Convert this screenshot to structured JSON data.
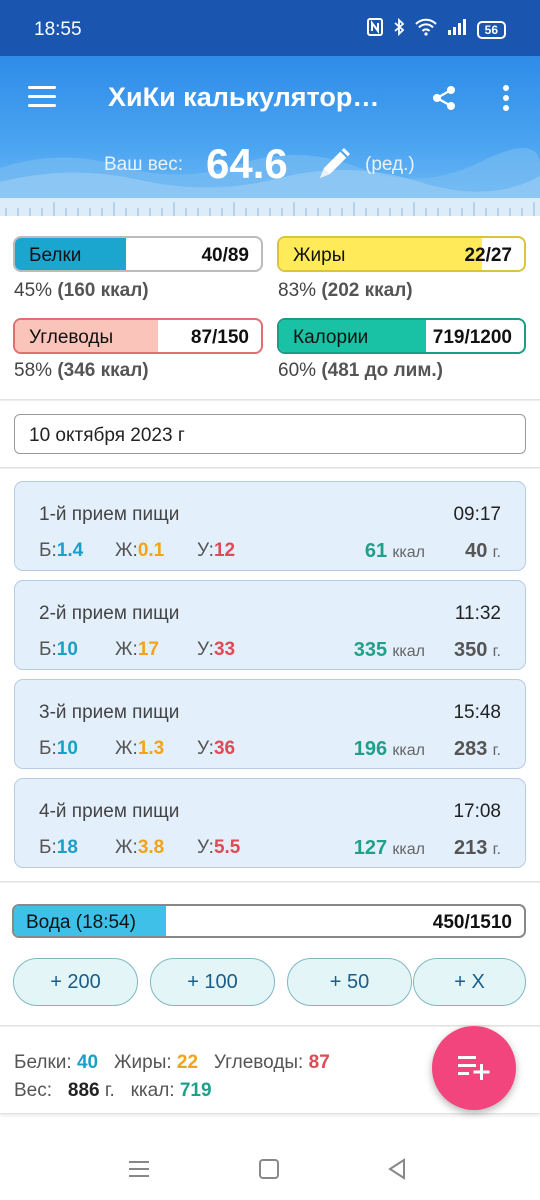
{
  "status_bar": {
    "time": "18:55",
    "battery": "56"
  },
  "header": {
    "title": "ХиКи калькулятор…"
  },
  "weight": {
    "label": "Ваш вес:",
    "value": "64.6",
    "edit_label": "(ред.)"
  },
  "macros": {
    "protein": {
      "name": "Белки",
      "value": "40/89",
      "percent": "45%",
      "detail": "(160 ккал)",
      "fill": 0.45,
      "color": "#1ba6cf"
    },
    "fat": {
      "name": "Жиры",
      "value": "22/27",
      "percent": "83%",
      "detail": "(202 ккал)",
      "fill": 0.83,
      "color": "#ffeb59"
    },
    "carbs": {
      "name": "Углеводы",
      "value": "87/150",
      "percent": "58%",
      "detail": "(346 ккал)",
      "fill": 0.58,
      "color": "#fbc4ba"
    },
    "calories": {
      "name": "Калории",
      "value": "719/1200",
      "percent": "60%",
      "detail": "(481 до лим.)",
      "fill": 0.6,
      "color": "#19c2a4"
    }
  },
  "date": {
    "value": "10 октября 2023 г"
  },
  "labels": {
    "protein_short": "Б:",
    "fat_short": "Ж:",
    "carbs_short": "У:",
    "kcal_unit": "ккал",
    "gram_unit": "г."
  },
  "meals": [
    {
      "name": "1-й прием пищи",
      "time": "09:17",
      "protein": "1.4",
      "fat": "0.1",
      "carbs": "12",
      "kcal": "61",
      "weight": "40"
    },
    {
      "name": "2-й прием пищи",
      "time": "11:32",
      "protein": "10",
      "fat": "17",
      "carbs": "33",
      "kcal": "335",
      "weight": "350"
    },
    {
      "name": "3-й прием пищи",
      "time": "15:48",
      "protein": "10",
      "fat": "1.3",
      "carbs": "36",
      "kcal": "196",
      "weight": "283"
    },
    {
      "name": "4-й прием пищи",
      "time": "17:08",
      "protein": "18",
      "fat": "3.8",
      "carbs": "5.5",
      "kcal": "127",
      "weight": "213"
    }
  ],
  "water": {
    "name": "Вода (18:54)",
    "value": "450/1510",
    "fill": 0.298,
    "buttons": [
      "+ 200",
      "+ 100",
      "+ 50",
      "+ X"
    ]
  },
  "summary": {
    "protein_label": "Белки:",
    "protein": "40",
    "fat_label": "Жиры:",
    "fat": "22",
    "carbs_label": "Углеводы:",
    "carbs": "87",
    "weight_label": "Вес:",
    "weight": "886",
    "gram": "г.",
    "kcal_label": "ккал:",
    "kcal": "719"
  }
}
